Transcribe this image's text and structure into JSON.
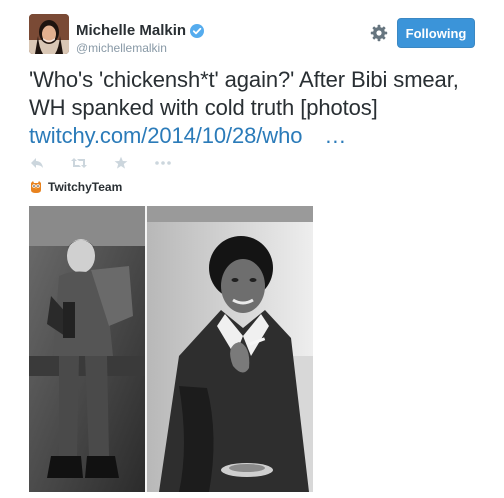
{
  "user": {
    "name": "Michelle Malkin",
    "handle": "@michellemalkin"
  },
  "header": {
    "follow_label": "Following"
  },
  "tweet": {
    "line1": "'Who's 'chickensh*t' again?' After Bibi smear,",
    "line2": "WH spanked with cold truth [photos]",
    "link_text": "twitchy.com/2014/10/28/who",
    "link_ellipsis": "…"
  },
  "actions": [
    "reply-icon",
    "retweet-icon",
    "favorite-icon",
    "more-icon"
  ],
  "attribution": {
    "label": "TwitchyTeam"
  },
  "colors": {
    "follow_bg": "#3b94d9",
    "link": "#2b7bb9",
    "verified": "#55acee",
    "muted": "#8899a6"
  }
}
